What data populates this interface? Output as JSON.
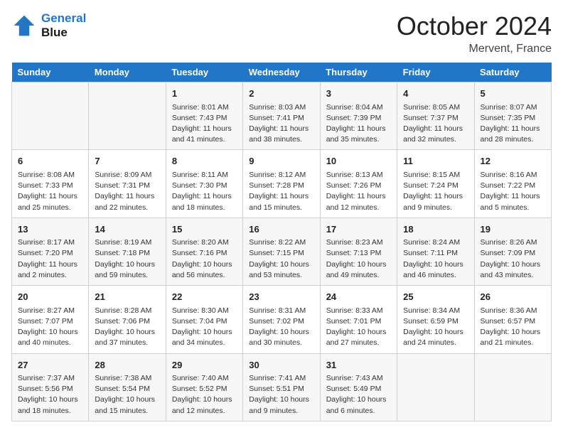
{
  "header": {
    "logo_line1": "General",
    "logo_line2": "Blue",
    "month": "October 2024",
    "location": "Mervent, France"
  },
  "weekdays": [
    "Sunday",
    "Monday",
    "Tuesday",
    "Wednesday",
    "Thursday",
    "Friday",
    "Saturday"
  ],
  "weeks": [
    [
      {
        "day": "",
        "info": ""
      },
      {
        "day": "",
        "info": ""
      },
      {
        "day": "1",
        "info": "Sunrise: 8:01 AM\nSunset: 7:43 PM\nDaylight: 11 hours and 41 minutes."
      },
      {
        "day": "2",
        "info": "Sunrise: 8:03 AM\nSunset: 7:41 PM\nDaylight: 11 hours and 38 minutes."
      },
      {
        "day": "3",
        "info": "Sunrise: 8:04 AM\nSunset: 7:39 PM\nDaylight: 11 hours and 35 minutes."
      },
      {
        "day": "4",
        "info": "Sunrise: 8:05 AM\nSunset: 7:37 PM\nDaylight: 11 hours and 32 minutes."
      },
      {
        "day": "5",
        "info": "Sunrise: 8:07 AM\nSunset: 7:35 PM\nDaylight: 11 hours and 28 minutes."
      }
    ],
    [
      {
        "day": "6",
        "info": "Sunrise: 8:08 AM\nSunset: 7:33 PM\nDaylight: 11 hours and 25 minutes."
      },
      {
        "day": "7",
        "info": "Sunrise: 8:09 AM\nSunset: 7:31 PM\nDaylight: 11 hours and 22 minutes."
      },
      {
        "day": "8",
        "info": "Sunrise: 8:11 AM\nSunset: 7:30 PM\nDaylight: 11 hours and 18 minutes."
      },
      {
        "day": "9",
        "info": "Sunrise: 8:12 AM\nSunset: 7:28 PM\nDaylight: 11 hours and 15 minutes."
      },
      {
        "day": "10",
        "info": "Sunrise: 8:13 AM\nSunset: 7:26 PM\nDaylight: 11 hours and 12 minutes."
      },
      {
        "day": "11",
        "info": "Sunrise: 8:15 AM\nSunset: 7:24 PM\nDaylight: 11 hours and 9 minutes."
      },
      {
        "day": "12",
        "info": "Sunrise: 8:16 AM\nSunset: 7:22 PM\nDaylight: 11 hours and 5 minutes."
      }
    ],
    [
      {
        "day": "13",
        "info": "Sunrise: 8:17 AM\nSunset: 7:20 PM\nDaylight: 11 hours and 2 minutes."
      },
      {
        "day": "14",
        "info": "Sunrise: 8:19 AM\nSunset: 7:18 PM\nDaylight: 10 hours and 59 minutes."
      },
      {
        "day": "15",
        "info": "Sunrise: 8:20 AM\nSunset: 7:16 PM\nDaylight: 10 hours and 56 minutes."
      },
      {
        "day": "16",
        "info": "Sunrise: 8:22 AM\nSunset: 7:15 PM\nDaylight: 10 hours and 53 minutes."
      },
      {
        "day": "17",
        "info": "Sunrise: 8:23 AM\nSunset: 7:13 PM\nDaylight: 10 hours and 49 minutes."
      },
      {
        "day": "18",
        "info": "Sunrise: 8:24 AM\nSunset: 7:11 PM\nDaylight: 10 hours and 46 minutes."
      },
      {
        "day": "19",
        "info": "Sunrise: 8:26 AM\nSunset: 7:09 PM\nDaylight: 10 hours and 43 minutes."
      }
    ],
    [
      {
        "day": "20",
        "info": "Sunrise: 8:27 AM\nSunset: 7:07 PM\nDaylight: 10 hours and 40 minutes."
      },
      {
        "day": "21",
        "info": "Sunrise: 8:28 AM\nSunset: 7:06 PM\nDaylight: 10 hours and 37 minutes."
      },
      {
        "day": "22",
        "info": "Sunrise: 8:30 AM\nSunset: 7:04 PM\nDaylight: 10 hours and 34 minutes."
      },
      {
        "day": "23",
        "info": "Sunrise: 8:31 AM\nSunset: 7:02 PM\nDaylight: 10 hours and 30 minutes."
      },
      {
        "day": "24",
        "info": "Sunrise: 8:33 AM\nSunset: 7:01 PM\nDaylight: 10 hours and 27 minutes."
      },
      {
        "day": "25",
        "info": "Sunrise: 8:34 AM\nSunset: 6:59 PM\nDaylight: 10 hours and 24 minutes."
      },
      {
        "day": "26",
        "info": "Sunrise: 8:36 AM\nSunset: 6:57 PM\nDaylight: 10 hours and 21 minutes."
      }
    ],
    [
      {
        "day": "27",
        "info": "Sunrise: 7:37 AM\nSunset: 5:56 PM\nDaylight: 10 hours and 18 minutes."
      },
      {
        "day": "28",
        "info": "Sunrise: 7:38 AM\nSunset: 5:54 PM\nDaylight: 10 hours and 15 minutes."
      },
      {
        "day": "29",
        "info": "Sunrise: 7:40 AM\nSunset: 5:52 PM\nDaylight: 10 hours and 12 minutes."
      },
      {
        "day": "30",
        "info": "Sunrise: 7:41 AM\nSunset: 5:51 PM\nDaylight: 10 hours and 9 minutes."
      },
      {
        "day": "31",
        "info": "Sunrise: 7:43 AM\nSunset: 5:49 PM\nDaylight: 10 hours and 6 minutes."
      },
      {
        "day": "",
        "info": ""
      },
      {
        "day": "",
        "info": ""
      }
    ]
  ]
}
